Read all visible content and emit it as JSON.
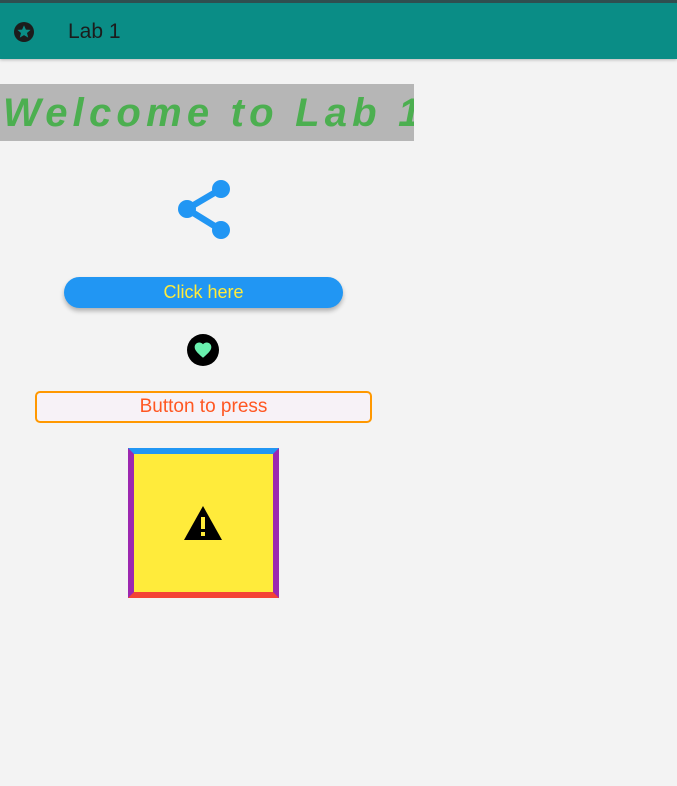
{
  "app_bar": {
    "icon": "star-circle-icon",
    "title": "Lab 1",
    "color": "#0a8d86"
  },
  "welcome": {
    "text": "Welcome to Lab 1",
    "text_color": "#4caf50",
    "background": "#b6b6b6"
  },
  "share": {
    "icon": "share-icon",
    "color": "#2196f3"
  },
  "click_button": {
    "label": "Click here",
    "background": "#2196f3",
    "text_color": "#ffeb3b"
  },
  "heart": {
    "icon": "heart-icon",
    "color": "#69f0ae",
    "background": "#000000"
  },
  "press_button": {
    "label": "Button to press",
    "border_color": "#ff9800",
    "text_color": "#ff5722"
  },
  "warning_box": {
    "icon": "warning-icon",
    "background": "#ffeb3b",
    "border_top": "#2196f3",
    "border_sides": "#9c27b0",
    "border_bottom": "#f44336"
  }
}
